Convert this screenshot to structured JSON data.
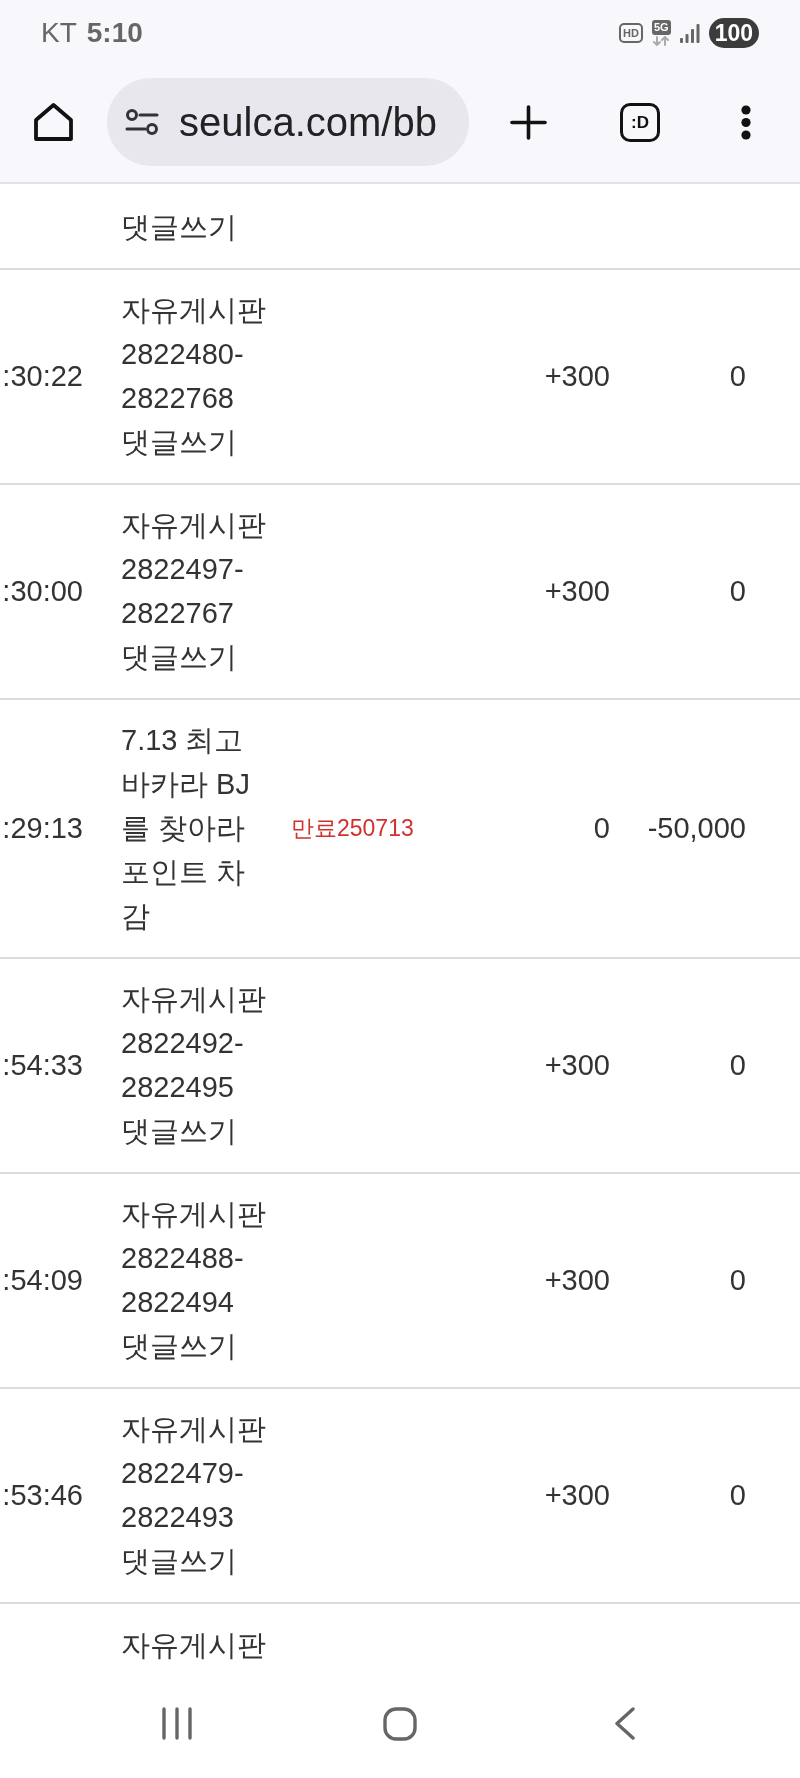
{
  "status_bar": {
    "carrier": "KT",
    "time": "5:10",
    "hd_label": "HD",
    "network_label": "5G",
    "battery": "100"
  },
  "browser_toolbar": {
    "url": "seulca.com/bb",
    "tab_count": ":D"
  },
  "table": {
    "top_fragment": "댓글쓰기",
    "rows": [
      {
        "time": ":30:22",
        "content": "자유게시판 2822480-2822768 댓글쓰기",
        "column_4": "+300",
        "column_5": "0"
      },
      {
        "time": ":30:00",
        "content": "자유게시판 2822497-2822767 댓글쓰기",
        "column_4": "+300",
        "column_5": "0"
      },
      {
        "time": ":29:13",
        "content": "7.13 최고 바카라 BJ를 찾아라 포인트 차감",
        "note": "만료250713",
        "column_4": "0",
        "column_5": "-50,000"
      },
      {
        "time": ":54:33",
        "content": "자유게시판 2822492-2822495 댓글쓰기",
        "column_4": "+300",
        "column_5": "0"
      },
      {
        "time": ":54:09",
        "content": "자유게시판 2822488-2822494 댓글쓰기",
        "column_4": "+300",
        "column_5": "0"
      },
      {
        "time": ":53:46",
        "content": "자유게시판 2822479-2822493 댓글쓰기",
        "column_4": "+300",
        "column_5": "0"
      }
    ],
    "bottom_fragment": "자유게시판"
  }
}
